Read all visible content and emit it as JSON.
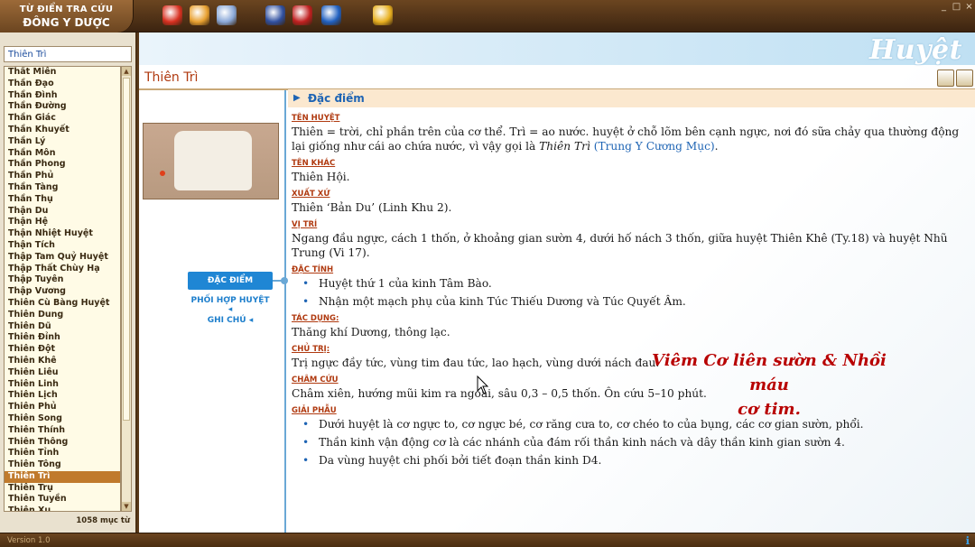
{
  "app": {
    "title_line1": "TỪ ĐIỂN TRA CỨU",
    "title_line2": "ĐÔNG Y DƯỢC",
    "banner": "Huyệt",
    "version": "Version 1.0",
    "window_controls": [
      "_",
      "□",
      "×"
    ]
  },
  "toolbar": {
    "icons": [
      {
        "name": "red-cross-icon",
        "color": "#d83020"
      },
      {
        "name": "medicine-box-icon",
        "color": "#e8a030"
      },
      {
        "name": "book-icon",
        "color": "#8aa8d8"
      },
      {
        "name": "body-chart-icon",
        "color": "#3050a0"
      },
      {
        "name": "herb-icon",
        "color": "#c02020"
      },
      {
        "name": "blue-book-icon",
        "color": "#2060c0"
      },
      {
        "name": "magnifier-icon",
        "color": "#e8b020"
      }
    ]
  },
  "sidebar": {
    "search_value": "Thiên Trì",
    "count": "1058 mục từ",
    "items": [
      "Thất Miên",
      "Thần Đạo",
      "Thần Đình",
      "Thần Đường",
      "Thần Giác",
      "Thần Khuyết",
      "Thần Lý",
      "Thần Môn",
      "Thần Phong",
      "Thần Phủ",
      "Thần Tàng",
      "Thần Thụ",
      "Thận Du",
      "Thận Hệ",
      "Thận Nhiệt Huyệt",
      "Thận Tích",
      "Thập Tam Quỷ Huyệt",
      "Thập Thất Chùy Hạ",
      "Thập Tuyên",
      "Thập Vương",
      "Thiên Cù Bàng Huyệt",
      "Thiên Dung",
      "Thiên Dũ",
      "Thiên Đỉnh",
      "Thiên Đột",
      "Thiên Khê",
      "Thiên Liêu",
      "Thiên Linh",
      "Thiên Lịch",
      "Thiên Phủ",
      "Thiên Song",
      "Thiên Thính",
      "Thiên Thông",
      "Thiên Tỉnh",
      "Thiên Tông",
      "Thiên Trì",
      "Thiên Trụ",
      "Thiên Tuyền",
      "Thiên Xu"
    ],
    "selected": "Thiên Trì"
  },
  "main": {
    "page_title": "Thiên Trì",
    "section_header": "Đặc điểm",
    "tabs": {
      "active": "ĐẶC ĐIỂM",
      "tab2": "PHỐI HỢP HUYỆT",
      "tab3": "GHI CHÚ"
    },
    "sections": {
      "ten_huyet_label": "TÊN HUYỆT",
      "ten_huyet_text": "Thiên = trời, chỉ phần trên của cơ thể. Trì = ao nước. huyệt ở chỗ lõm bên cạnh ngực, nơi đó sữa chảy qua thường động lại giống như cái ao chứa nước, vì vậy gọi là ",
      "ten_huyet_em": "Thiên Trì",
      "ten_huyet_ref": "(Trung Y Cương Mục)",
      "ten_huyet_end": ".",
      "ten_khac_label": "TÊN KHÁC",
      "ten_khac_text": "Thiên Hội.",
      "xuat_xu_label": "XUẤT XỨ",
      "xuat_xu_text": "Thiên ‘Bản Du’ (Linh Khu 2).",
      "vi_tri_label": "VỊ TRÍ",
      "vi_tri_text": "Ngang đầu ngực, cách 1 thốn, ở khoảng gian sườn 4, dưới hố nách 3 thốn, giữa huyệt Thiên Khê (Ty.18) và huyệt Nhũ Trung (Vi 17).",
      "dac_tinh_label": "ĐẶC TÍNH",
      "dac_tinh_items": [
        "Huyệt thứ 1 của kinh Tâm Bào.",
        "Nhận một mạch phụ của kinh Túc Thiếu Dương và Túc Quyết Âm."
      ],
      "tac_dung_label": "TÁC DỤNG:",
      "tac_dung_text": "Thăng khí Dương, thông lạc.",
      "chu_tri_label": "CHỦ TRỊ:",
      "chu_tri_text": "Trị ngực đầy tức, vùng tim đau tức, lao hạch, vùng dưới nách đau.",
      "cham_cuu_label": "CHÂM CỨU",
      "cham_cuu_text": "Châm xiên, hướng mũi kim ra ngoài, sâu 0,3 – 0,5 thốn. Ôn cứu 5–10 phút.",
      "giai_phau_label": "GIẢI PHẪU",
      "giai_phau_items": [
        "Dưới huyệt là cơ ngực to, cơ ngực bé, cơ răng cưa to, cơ chéo to của bụng, các cơ gian sườn, phổi.",
        "Thần kinh vận động cơ là các nhánh của đám rối thần kinh nách và dây thần kinh gian sườn 4.",
        "Da vùng huyệt chi phối bởi tiết đoạn thần kinh D4."
      ]
    },
    "overlay_line1": "Viêm Cơ liên sườn & Nhồi máu",
    "overlay_line2": "cơ tim."
  }
}
